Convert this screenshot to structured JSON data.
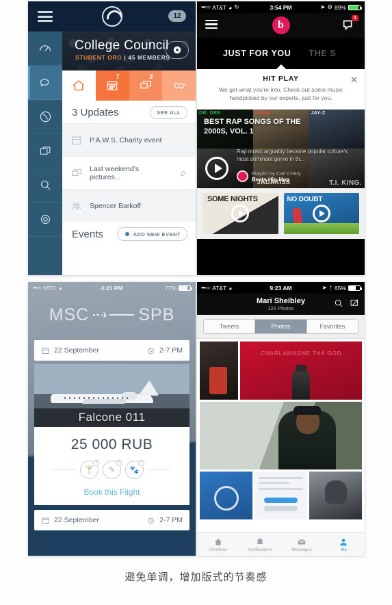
{
  "caption": "避免单调，增加版式的节奏感",
  "panel_college": {
    "topbar": {
      "menu_icon": "hamburger-icon",
      "logo_icon": "app-logo-icon",
      "notification_count": "12"
    },
    "hero": {
      "title": "College Council",
      "org": "STUDENT ORG",
      "separator": " | ",
      "members": "45 MEMBERS",
      "settings_icon": "gear-icon"
    },
    "rail": [
      {
        "name": "dashboard",
        "icon": "speedometer-icon",
        "active": false
      },
      {
        "name": "messages",
        "icon": "speech-bubble-icon",
        "active": true
      },
      {
        "name": "globe",
        "icon": "globe-icon",
        "active": false
      },
      {
        "name": "cards",
        "icon": "windows-icon",
        "active": false
      },
      {
        "name": "search",
        "icon": "search-icon",
        "active": false
      },
      {
        "name": "settings",
        "icon": "gear-icon",
        "active": false
      }
    ],
    "tabs": [
      {
        "icon": "home-icon",
        "badge": "",
        "active": true
      },
      {
        "icon": "calendar-icon",
        "badge": "7",
        "active": false
      },
      {
        "icon": "chat-icon",
        "badge": "3",
        "active": false
      },
      {
        "icon": "handshake-icon",
        "badge": "",
        "active": false
      }
    ],
    "updates": {
      "title": "3 Updates",
      "see_all": "SEE ALL"
    },
    "rows": [
      {
        "icon": "calendar-icon",
        "text": "P.A.W.S. Charity event",
        "attachment": false
      },
      {
        "icon": "chat-icon",
        "text": "Last weekend's pictures...",
        "attachment": true
      },
      {
        "icon": "people-icon",
        "text": "Spencer Barkoff",
        "attachment": false
      }
    ],
    "events": {
      "title": "Events",
      "add_label": "ADD NEW EVENT"
    }
  },
  "panel_beats": {
    "status": {
      "dots": "•••○○",
      "carrier": "AT&T",
      "wifi_icon": "wifi-icon",
      "sync_icon": "sync-icon",
      "time": "3:54 PM",
      "location_icon": "location-icon",
      "alarm_icon": "alarm-icon",
      "battery": "89%"
    },
    "nav": {
      "menu_icon": "hamburger-icon",
      "logo_icon": "beats-logo-icon",
      "notify_icon": "notification-icon",
      "notify_count": "1"
    },
    "tabs": [
      {
        "label": "JUST FOR YOU",
        "active": true
      },
      {
        "label": "THE S",
        "active": false
      }
    ],
    "promo": {
      "title": "HIT PLAY",
      "body": "We get what you're into. Check out some music handpicked by our experts, just for you.",
      "close_icon": "close-icon"
    },
    "featured": {
      "title": "BEST RAP SONGS OF THE 2000S, VOL. 1",
      "description": "Rap music arguably became popular culture's most dominant genre in th...",
      "by_prefix": "Playlist by Carl Chery",
      "by_name": "Beats Hip-Hop",
      "play_icon": "play-icon",
      "tile_labels": [
        "DR. DRE",
        "GAME",
        "JAY-Z",
        "",
        "JADAKISS",
        "T.I. KING."
      ]
    },
    "albums": [
      {
        "title": "SOME NIGHTS",
        "play_icon": "play-icon"
      },
      {
        "title": "NO DOUBT",
        "play_icon": "play-icon"
      }
    ]
  },
  "panel_flight": {
    "status": {
      "dots": "•••○○",
      "carrier": "MTC",
      "wifi_icon": "wifi-icon",
      "time": "4:21 PM",
      "battery": "77%"
    },
    "route": {
      "from": "MSC",
      "to": "SPB",
      "plane_icon": "airplane-icon"
    },
    "bar_top": {
      "calendar_icon": "calendar-icon",
      "date": "22 September",
      "clock_icon": "alarm-clock-icon",
      "time": "2-7 PM"
    },
    "aircraft": {
      "name": "Falcone 011"
    },
    "price": {
      "amount": "25 000 RUB"
    },
    "amenities": [
      {
        "icon": "drink-icon",
        "badge": "?"
      },
      {
        "icon": "wifi-pen-icon",
        "badge": "?"
      },
      {
        "icon": "pet-icon",
        "badge": "?"
      }
    ],
    "book_label": "Book this Flight",
    "bar_bottom": {
      "calendar_icon": "calendar-icon",
      "date": "22 September",
      "clock_icon": "alarm-clock-icon",
      "time": "2-7 PM"
    }
  },
  "panel_twitter": {
    "status": {
      "dots": "•••○○",
      "carrier": "AT&T",
      "wifi_icon": "wifi-icon",
      "time": "9:23 AM",
      "location_icon": "location-icon",
      "bluetooth_icon": "bluetooth-icon",
      "battery": "65%"
    },
    "nav": {
      "name": "Mari Sheibley",
      "count": "121 Photos",
      "search_icon": "search-icon",
      "compose_icon": "compose-icon"
    },
    "segments": [
      {
        "label": "Tweets",
        "active": false
      },
      {
        "label": "Photos",
        "active": true
      },
      {
        "label": "Favorites",
        "active": false
      }
    ],
    "photos": [
      {
        "alt": "desk-photo",
        "caption": ""
      },
      {
        "alt": "charlamagne-photo",
        "caption": "CHARLAMAGNE THA GOD"
      },
      {
        "alt": "street-portrait-photo",
        "caption": ""
      },
      {
        "alt": "tshirt-photo",
        "caption": ""
      },
      {
        "alt": "screenshot-photo",
        "caption": ""
      },
      {
        "alt": "statue-photo",
        "caption": ""
      }
    ],
    "tabbar": [
      {
        "label": "Timelines",
        "icon": "home-icon",
        "active": false
      },
      {
        "label": "Notifications",
        "icon": "bell-icon",
        "active": false
      },
      {
        "label": "Messages",
        "icon": "envelope-icon",
        "active": false
      },
      {
        "label": "Me",
        "icon": "person-icon",
        "active": true
      }
    ]
  },
  "colors": {
    "college_dark": "#0f2139",
    "college_rail": "#2e5974",
    "orange": "#f4743b",
    "beats_pink": "#e2185b",
    "flight_blue": "#1d3f5d",
    "twitter_blue": "#2b9fe0"
  }
}
